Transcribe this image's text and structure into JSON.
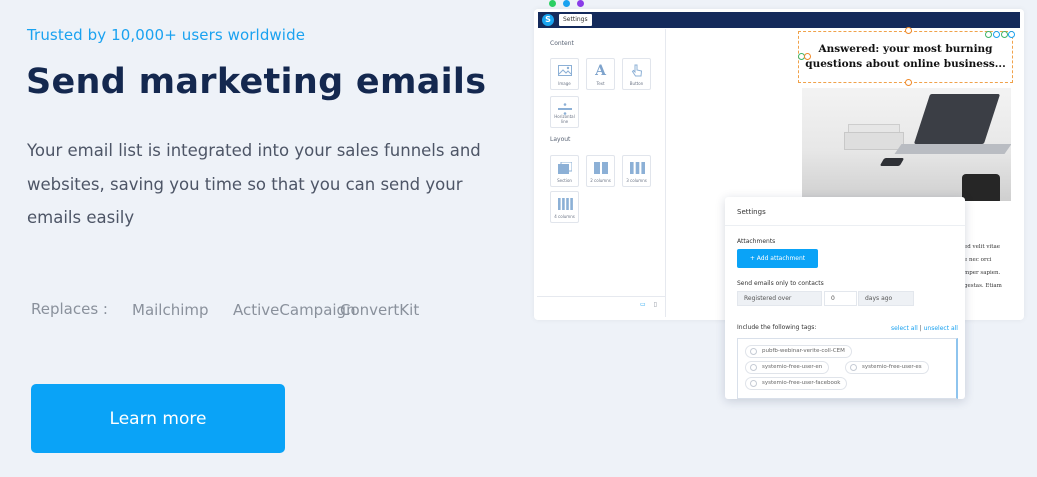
{
  "hero": {
    "tagline": "Trusted by 10,000+ users worldwide",
    "title": "Send marketing emails",
    "description": "Your email list is integrated into your sales funnels and websites, saving you time so that you can send your emails easily",
    "replaces_label": "Replaces :",
    "replaces": [
      "Mailchimp",
      "ActiveCampaign",
      "ConvertKit"
    ],
    "cta_label": "Learn more"
  },
  "colors": {
    "accent": "#0aa3f7",
    "title": "#14284f",
    "window_dots": [
      "#2bcf63",
      "#1aa2f0",
      "#8a3ce8"
    ]
  },
  "editor": {
    "logo": "S",
    "tab": "Settings",
    "content_label": "Content",
    "content_blocks": [
      {
        "label": "Image",
        "icon": "image-icon"
      },
      {
        "label": "Text",
        "icon": "text-icon"
      },
      {
        "label": "Button",
        "icon": "pointer-icon"
      },
      {
        "label": "Horizontal line",
        "icon": "divider-icon"
      }
    ],
    "layout_label": "Layout",
    "layout_blocks": [
      {
        "label": "Section",
        "icon": "section-icon"
      },
      {
        "label": "2 columns",
        "icon": "two-columns-icon"
      },
      {
        "label": "3 columns",
        "icon": "three-columns-icon"
      },
      {
        "label": "4 columns",
        "icon": "four-columns-icon"
      }
    ],
    "headline": "Answered: your most burning questions about online business...",
    "text_fragments": [
      "ed velit vitae",
      "e nec orci",
      "mper sapien.",
      "gestas. Etiam"
    ]
  },
  "settings_modal": {
    "title": "Settings",
    "attachments_label": "Attachments",
    "add_attachment": "+ Add attachment",
    "send_only_label": "Send emails only to contacts",
    "condition": "Registered over",
    "days_value": "0",
    "days_unit": "days ago",
    "tags_label": "Include the following tags:",
    "select_all": "select all",
    "unselect_all": "unselect all",
    "tags": [
      "pubfb-webinar-verite-coll-CEM",
      "systemio-free-user-en",
      "systemio-free-user-es",
      "systemio-free-user-facebook"
    ]
  }
}
